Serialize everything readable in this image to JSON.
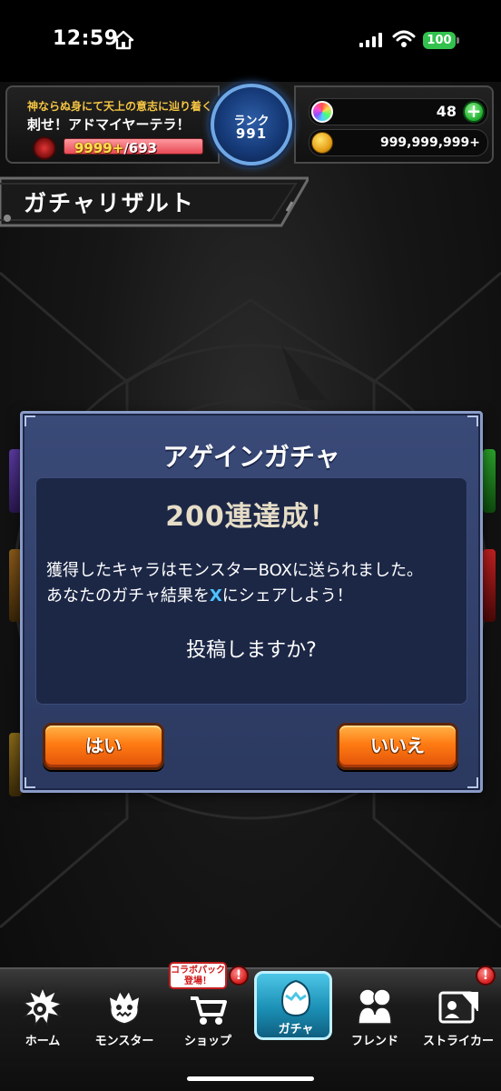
{
  "status_bar": {
    "time": "12:59",
    "battery": "100"
  },
  "hud": {
    "quest_subtitle": "神ならぬ身にて天上の意志に辿り着くもの",
    "quest_title": "刺せ！アドマイヤーテラ！",
    "stamina_current": "9999+",
    "stamina_max": "/693",
    "rank_label": "ランク",
    "rank_value": "991",
    "orbs": "48",
    "coins": "999,999,999+",
    "plus": "+"
  },
  "page_title": "ガチャリザルト",
  "dialog": {
    "title": "アゲインガチャ",
    "achievement": "200連達成！",
    "message_line1": "獲得したキャラはモンスターBOXに送られました。",
    "message_line2_pre": "あなたのガチャ結果を",
    "message_line2_x": "X",
    "message_line2_post": "にシェアしよう！",
    "question": "投稿しますか?",
    "yes_label": "はい",
    "no_label": "いいえ"
  },
  "nav": {
    "items": [
      {
        "label": "ホーム",
        "icon": "home-icon"
      },
      {
        "label": "モンスター",
        "icon": "monster-icon"
      },
      {
        "label": "ショップ",
        "icon": "cart-icon"
      },
      {
        "label": "ガチャ",
        "icon": "egg-icon"
      },
      {
        "label": "フレンド",
        "icon": "friends-icon"
      },
      {
        "label": "ストライカー",
        "icon": "striker-card-icon"
      }
    ],
    "collab_badge_line1": "コラボパック",
    "collab_badge_line2": "登場！",
    "alert": "!"
  },
  "colors": {
    "dialog_bg": "#2b3960",
    "button_orange": "#ff7a12",
    "active_tab": "#1b8fb5",
    "x_blue": "#4dc3ff"
  }
}
